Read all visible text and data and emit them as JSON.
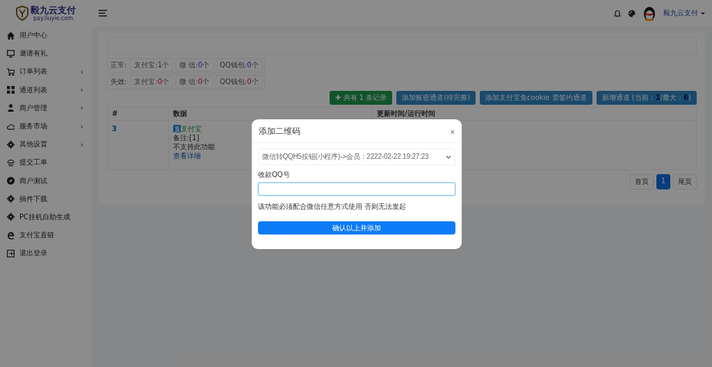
{
  "brand": {
    "name": "毅九云支付",
    "domain": "pay.liuyie.com"
  },
  "sidebar": {
    "items": [
      {
        "label": "用户中心"
      },
      {
        "label": "邀请有礼"
      },
      {
        "label": "订单列表",
        "arrow": "›"
      },
      {
        "label": "通道列表",
        "arrow": "›"
      },
      {
        "label": "商户管理",
        "arrow": "›"
      },
      {
        "label": "服务市场",
        "arrow": "›"
      },
      {
        "label": "其他设置",
        "arrow": "›"
      },
      {
        "label": "提交工单"
      },
      {
        "label": "商户测试"
      },
      {
        "label": "插件下载"
      },
      {
        "label": "PC挂机自助生成"
      },
      {
        "label": "支付宝直链"
      },
      {
        "label": "退出登录"
      }
    ]
  },
  "header": {
    "user": "毅九云支付"
  },
  "stats": [
    {
      "label": "正常:",
      "kind": "normal",
      "chips": [
        {
          "name": "支付宝:",
          "count": "1",
          "unit": "个"
        },
        {
          "name": "微 信:",
          "count": "0",
          "unit": "个"
        },
        {
          "name": "QQ钱包:",
          "count": "0",
          "unit": "个"
        }
      ]
    },
    {
      "label": "失效:",
      "kind": "failed",
      "chips": [
        {
          "name": "支付宝:",
          "count": "0",
          "unit": "个"
        },
        {
          "name": "微 信:",
          "count": "0",
          "unit": "个"
        },
        {
          "name": "QQ钱包:",
          "count": "0",
          "unit": "个"
        }
      ]
    }
  ],
  "actions": [
    {
      "kind": "green",
      "parts": [
        {
          "text": "✚ 共有 1 条记录",
          "highlight": false
        }
      ]
    },
    {
      "kind": "blue",
      "parts": [
        {
          "text": "添加账密通道(待完善)",
          "highlight": false
        }
      ]
    },
    {
      "kind": "blue",
      "parts": [
        {
          "text": "添加支付宝免cookie 需签约通道",
          "highlight": false
        }
      ]
    },
    {
      "kind": "blue",
      "parts": [
        {
          "text": "新增通道 (当前：",
          "highlight": false
        },
        {
          "text": "1",
          "highlight": true
        },
        {
          "text": "/最大：",
          "highlight": false
        },
        {
          "text": "6",
          "highlight": true
        },
        {
          "text": ")",
          "highlight": false
        }
      ]
    }
  ],
  "table": {
    "columns": [
      "#",
      "数据",
      "更新时间/运行时间"
    ],
    "rows": [
      {
        "id": "3",
        "channel": "支付宝",
        "note": "备注:[1]",
        "status": "不支持此功能",
        "link": "查看详细"
      }
    ]
  },
  "pagination": {
    "first": "首页",
    "pages": [
      {
        "label": "1",
        "selected": true
      }
    ],
    "last": "尾页"
  },
  "dialog": {
    "title": "添加二维码",
    "close": "×",
    "select": "微信转QQH5按钮(小程序)->会员：2222-02-22 19:27:23",
    "field_label": "收款QQ号",
    "note": "该功能必须配合微信任意方式使用 否则无法发起",
    "submit": "确认以上并添加"
  }
}
